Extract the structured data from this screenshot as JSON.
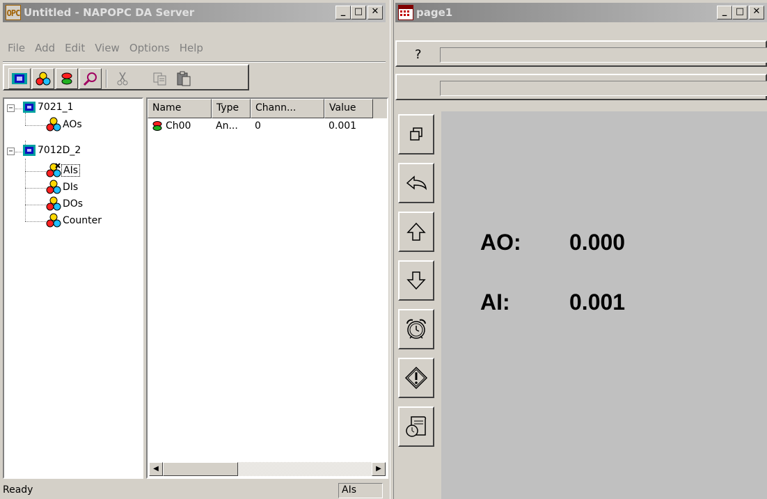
{
  "left_window": {
    "title": "Untitled - NAPOPC DA Server",
    "title_icon_text": "OPC",
    "menu": [
      "File",
      "Add",
      "Edit",
      "View",
      "Options",
      "Help"
    ],
    "tree": {
      "nodes": [
        {
          "label": "7021_1"
        },
        {
          "label": "AOs"
        },
        {
          "label": "7012D_2"
        },
        {
          "label": "AIs"
        },
        {
          "label": "DIs"
        },
        {
          "label": "DOs"
        },
        {
          "label": "Counter"
        }
      ],
      "expander": "−"
    },
    "list": {
      "columns": [
        "Name",
        "Type",
        "Chann...",
        "Value"
      ],
      "rows": [
        {
          "name": "Ch00",
          "type": "An...",
          "channel": "0",
          "value": "0.001"
        }
      ]
    },
    "status": {
      "text": "Ready",
      "panel": "AIs"
    }
  },
  "right_window": {
    "title": "page1",
    "help_symbol": "?",
    "readings": [
      {
        "label": "AO:",
        "value": "0.000"
      },
      {
        "label": "AI:",
        "value": "0.001"
      }
    ]
  },
  "colors": {
    "title_inactive_start": "#808080",
    "title_inactive_end": "#c0c0c0",
    "face": "#d4d0c8"
  }
}
